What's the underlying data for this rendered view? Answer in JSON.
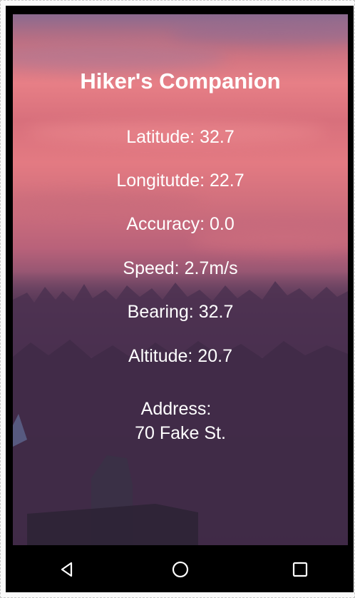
{
  "app": {
    "title": "Hiker's Companion"
  },
  "readings": {
    "latitude": "Latitude: 32.7",
    "longitude": "Longitutde: 22.7",
    "accuracy": "Accuracy: 0.0",
    "speed": "Speed: 2.7m/s",
    "bearing": "Bearing: 32.7",
    "altitude": "Altitude: 20.7"
  },
  "address": {
    "label": "Address:",
    "value": "70 Fake St."
  },
  "nav": {
    "back_icon": "back-triangle-icon",
    "home_icon": "home-circle-icon",
    "recents_icon": "recents-square-icon"
  },
  "colors": {
    "text": "#ffffff",
    "navbar": "#000000",
    "sky_accent": "#e77f86"
  }
}
